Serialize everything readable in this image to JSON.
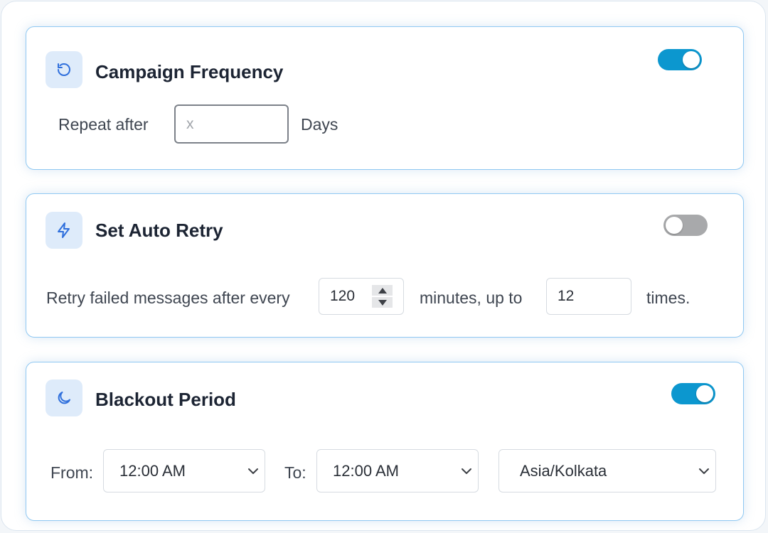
{
  "colors": {
    "accent": "#0c97cf",
    "icon_blue": "#2f6fdc",
    "icon_bg": "#deebfa",
    "card_border": "#8fc8f2",
    "toggle_off": "#a8a9ab"
  },
  "campaign_frequency": {
    "icon": "refresh-icon",
    "title": "Campaign Frequency",
    "enabled": true,
    "repeat_label": "Repeat after",
    "repeat_value": "",
    "repeat_placeholder": "x",
    "unit_label": "Days"
  },
  "auto_retry": {
    "icon": "lightning-icon",
    "title": "Set Auto Retry",
    "enabled": false,
    "prefix_label": "Retry failed messages after every",
    "minutes_value": "120",
    "middle_label": "minutes, up to",
    "times_value": "12",
    "suffix_label": "times."
  },
  "blackout_period": {
    "icon": "moon-icon",
    "title": "Blackout Period",
    "enabled": true,
    "from_label": "From:",
    "from_value": "12:00 AM",
    "to_label": "To:",
    "to_value": "12:00 AM",
    "timezone_value": "Asia/Kolkata"
  }
}
